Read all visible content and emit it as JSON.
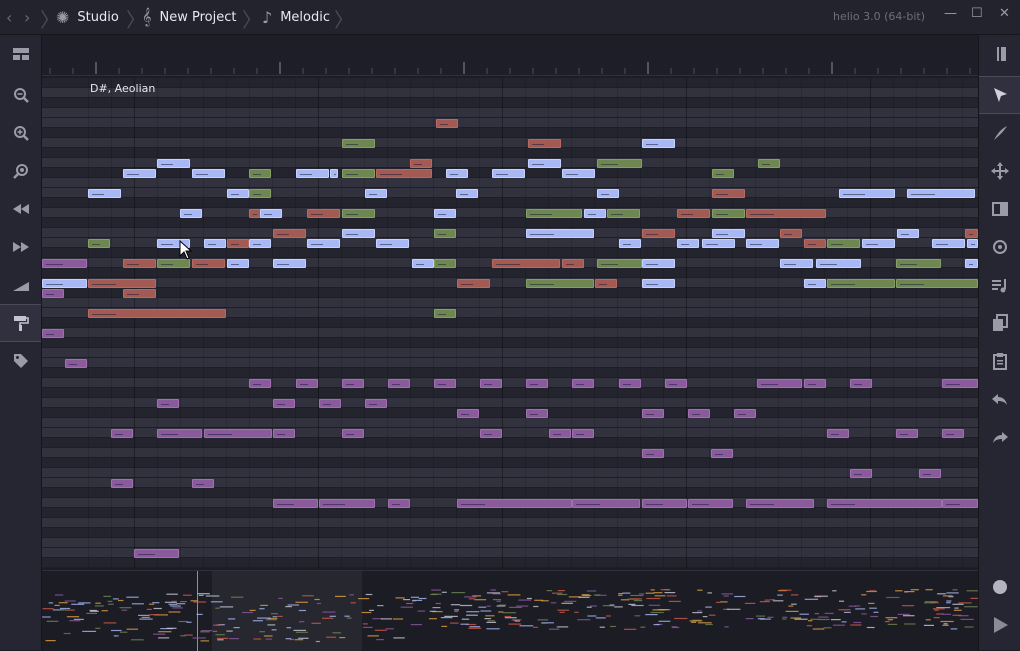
{
  "titlebar": {
    "breadcrumbs": [
      {
        "label": "Studio",
        "icon": "gear-icon"
      },
      {
        "label": "New Project",
        "icon": "treble-clef-icon"
      },
      {
        "label": "Melodic",
        "icon": "music-note-icon"
      }
    ],
    "version": "helio 3.0 (64-bit)",
    "window_controls": [
      "minimize-icon",
      "maximize-icon",
      "close-icon"
    ]
  },
  "left_toolbar": [
    "tracks-view-icon",
    "zoom-out-icon",
    "zoom-in-icon",
    "zoom-to-fit-icon",
    "rewind-icon",
    "fast-forward-icon",
    "velocity-ramp-icon",
    "paint-roller-icon",
    "tag-icon"
  ],
  "right_toolbar": [
    "collapse-panel-icon",
    "select-cursor-icon",
    "pen-icon",
    "drag-move-icon",
    "mirror-icon",
    "target-icon",
    "arpeggio-icon",
    "copy-icon",
    "paste-icon",
    "undo-icon",
    "redo-icon",
    "record-icon",
    "play-icon"
  ],
  "piano_roll": {
    "key_signature": "D#, Aeolian",
    "colors": {
      "blue": "#a8b8f4",
      "red": "#a25a52",
      "green": "#6e8750",
      "purple": "#8a5a9c",
      "purple_dark": "#7a4e8a"
    }
  }
}
